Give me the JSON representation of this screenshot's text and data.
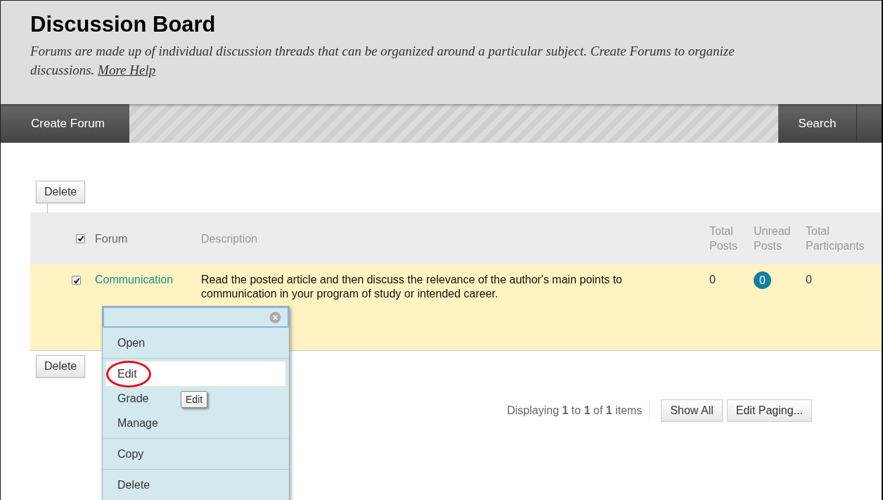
{
  "header": {
    "title": "Discussion Board",
    "description": "Forums are made up of individual discussion threads that can be organized around a particular subject. Create Forums to organize discussions.",
    "help_link": "More Help"
  },
  "action_bar": {
    "create_button": "Create Forum",
    "search_button": "Search"
  },
  "top_delete": "Delete",
  "table": {
    "select_all_checked": true,
    "columns": [
      "Forum",
      "Description",
      "Total Posts",
      "Unread Posts",
      "Total Participants"
    ],
    "rows": [
      {
        "checked": true,
        "forum": "Communication",
        "description": "Read the posted article and then discuss the relevance of the author's main points to communication in your program of study or intended career.",
        "total_posts": "0",
        "unread_posts": "0",
        "total_participants": "0"
      }
    ]
  },
  "bottom_delete": "Delete",
  "paging": {
    "text": "Displaying **1** to **1** of **1** items",
    "show_all": "Show All",
    "edit_paging": "Edit Paging..."
  },
  "context_menu": {
    "groups": [
      [
        {
          "label": "Open",
          "selected": false
        }
      ],
      [
        {
          "label": "Edit",
          "selected": true
        },
        {
          "label": "Grade",
          "selected": false
        },
        {
          "label": "Manage",
          "selected": false
        }
      ],
      [
        {
          "label": "Copy",
          "selected": false
        }
      ],
      [
        {
          "label": "Delete",
          "selected": false
        }
      ]
    ],
    "tooltip": "Edit"
  }
}
